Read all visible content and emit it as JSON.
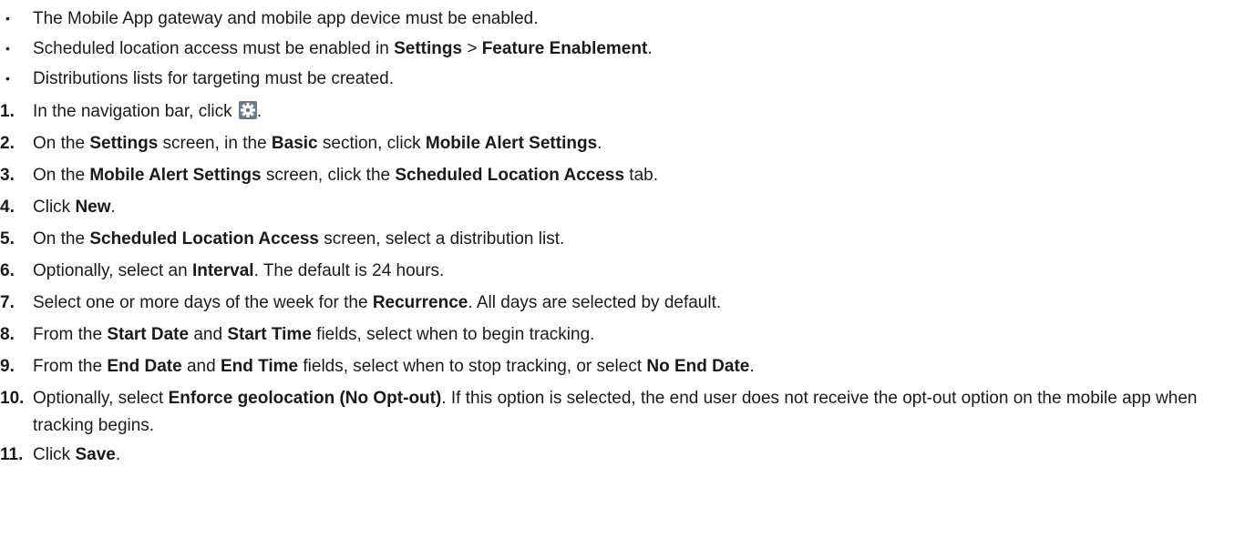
{
  "prerequisites": [
    {
      "text": "The Mobile App gateway and mobile app device must be enabled."
    },
    {
      "pre": "Scheduled location access must be enabled in ",
      "b1": "Settings",
      "mid": " > ",
      "b2": "Feature Enablement",
      "post": "."
    },
    {
      "text": "Distributions lists for targeting must be created."
    }
  ],
  "bullet_char": "•",
  "steps": [
    {
      "num": "1.",
      "pre": "In the navigation bar, click ",
      "icon": "gear-icon",
      "post": "."
    },
    {
      "num": "2.",
      "a": "On the ",
      "b1": "Settings",
      "c": " screen, in the ",
      "b2": "Basic",
      "d": " section, click ",
      "b3": "Mobile Alert Settings",
      "e": "."
    },
    {
      "num": "3.",
      "a": "On the ",
      "b1": "Mobile Alert Settings",
      "c": " screen, click the ",
      "b2": "Scheduled Location Access",
      "d": " tab."
    },
    {
      "num": "4.",
      "a": "Click ",
      "b1": "New",
      "c": "."
    },
    {
      "num": "5.",
      "a": "On the ",
      "b1": "Scheduled Location Access",
      "c": " screen, select a distribution list."
    },
    {
      "num": "6.",
      "a": "Optionally, select an ",
      "b1": "Interval",
      "c": ". The default is 24 hours."
    },
    {
      "num": "7.",
      "a": "Select one or more days of the week for the ",
      "b1": "Recurrence",
      "c": ". All days are selected by default."
    },
    {
      "num": "8.",
      "a": "From the ",
      "b1": "Start Date",
      "c": " and ",
      "b2": "Start Time",
      "d": " fields, select when to begin tracking."
    },
    {
      "num": "9.",
      "a": "From the ",
      "b1": "End Date",
      "c": " and ",
      "b2": "End Time",
      "d": " fields, select when to stop tracking, or select ",
      "b3": "No End Date",
      "e": "."
    },
    {
      "num": "10.",
      "a": "Optionally, select ",
      "b1": "Enforce geolocation (No Opt-out)",
      "c": ". If this option is selected, the end user does not receive the opt-out option on the mobile app when tracking begins."
    },
    {
      "num": "11.",
      "a": "Click ",
      "b1": "Save",
      "c": "."
    }
  ],
  "colors": {
    "text": "#1a1a1a",
    "icon_bg": "#6a7b8c"
  }
}
